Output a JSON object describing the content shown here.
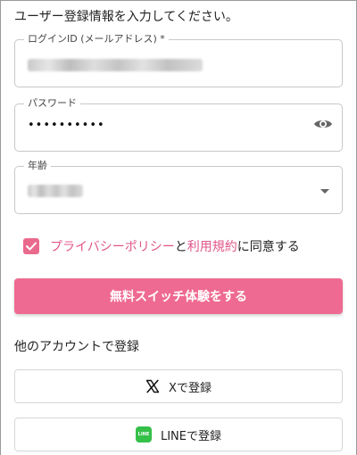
{
  "intro": "ユーザー登録情報を入力してください。",
  "fields": {
    "login_id": {
      "label": "ログインID (メールアドレス) *"
    },
    "password": {
      "label": "パスワード",
      "value_masked": "••••••••••"
    },
    "age": {
      "label": "年齢"
    }
  },
  "consent": {
    "checked": true,
    "privacy_link": "プライバシーポリシー",
    "and": "と",
    "terms_link": "利用規約",
    "suffix": "に同意する"
  },
  "primary_button": "無料スイッチ体験をする",
  "other_accounts": {
    "title": "他のアカウントで登録",
    "x_button": "Xで登録",
    "line_button": "LINEで登録",
    "line_icon_text": "LINE"
  },
  "colors": {
    "accent": "#ee6a92",
    "link": "#e15589",
    "line_green": "#35c04a"
  },
  "icons": {
    "password_toggle": "eye-icon",
    "checkbox": "check-icon",
    "x_logo": "x-logo-icon",
    "line_logo": "line-logo-icon",
    "dropdown": "caret-down-icon"
  }
}
